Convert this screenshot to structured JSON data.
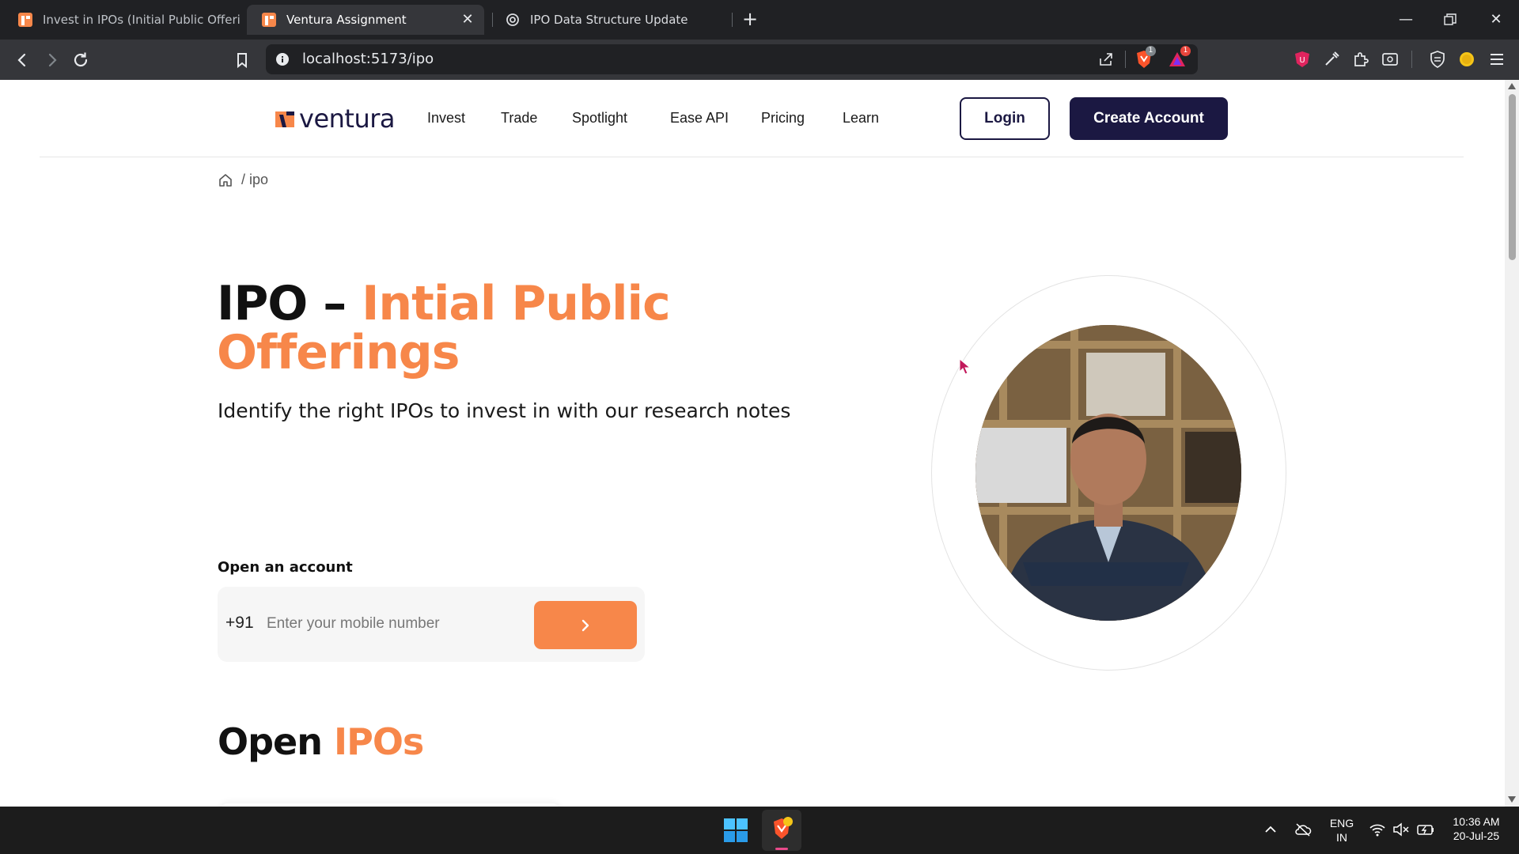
{
  "browser": {
    "tabs": [
      {
        "title": "Invest in IPOs (Initial Public Offering)"
      },
      {
        "title": "Ventura Assignment"
      },
      {
        "title": "IPO Data Structure Update"
      }
    ],
    "url": "localhost:5173/ipo",
    "extension_badges": {
      "brave_shield": "1",
      "rewards": "1"
    }
  },
  "site": {
    "logo_text": "ventura",
    "nav": [
      "Invest",
      "Trade",
      "Spotlight",
      "Ease API",
      "Pricing",
      "Learn"
    ],
    "login_label": "Login",
    "create_account_label": "Create Account",
    "breadcrumb": "/ ipo"
  },
  "hero": {
    "title_plain": "IPO – ",
    "title_accent": "Intial Public Offerings",
    "subtitle": "Identify the right IPOs to invest in with our research notes",
    "open_account_label": "Open an account",
    "country_code": "+91",
    "phone_placeholder": "Enter your mobile number"
  },
  "open_ipos": {
    "title_plain": "Open ",
    "title_accent": "IPOs"
  },
  "taskbar": {
    "lang_primary": "ENG",
    "lang_secondary": "IN",
    "time": "10:36 AM",
    "date": "20-Jul-25"
  },
  "colors": {
    "brand_navy": "#1b1842",
    "brand_orange": "#f7874a",
    "chrome_dark": "#202124",
    "chrome_toolbar": "#35363a"
  }
}
